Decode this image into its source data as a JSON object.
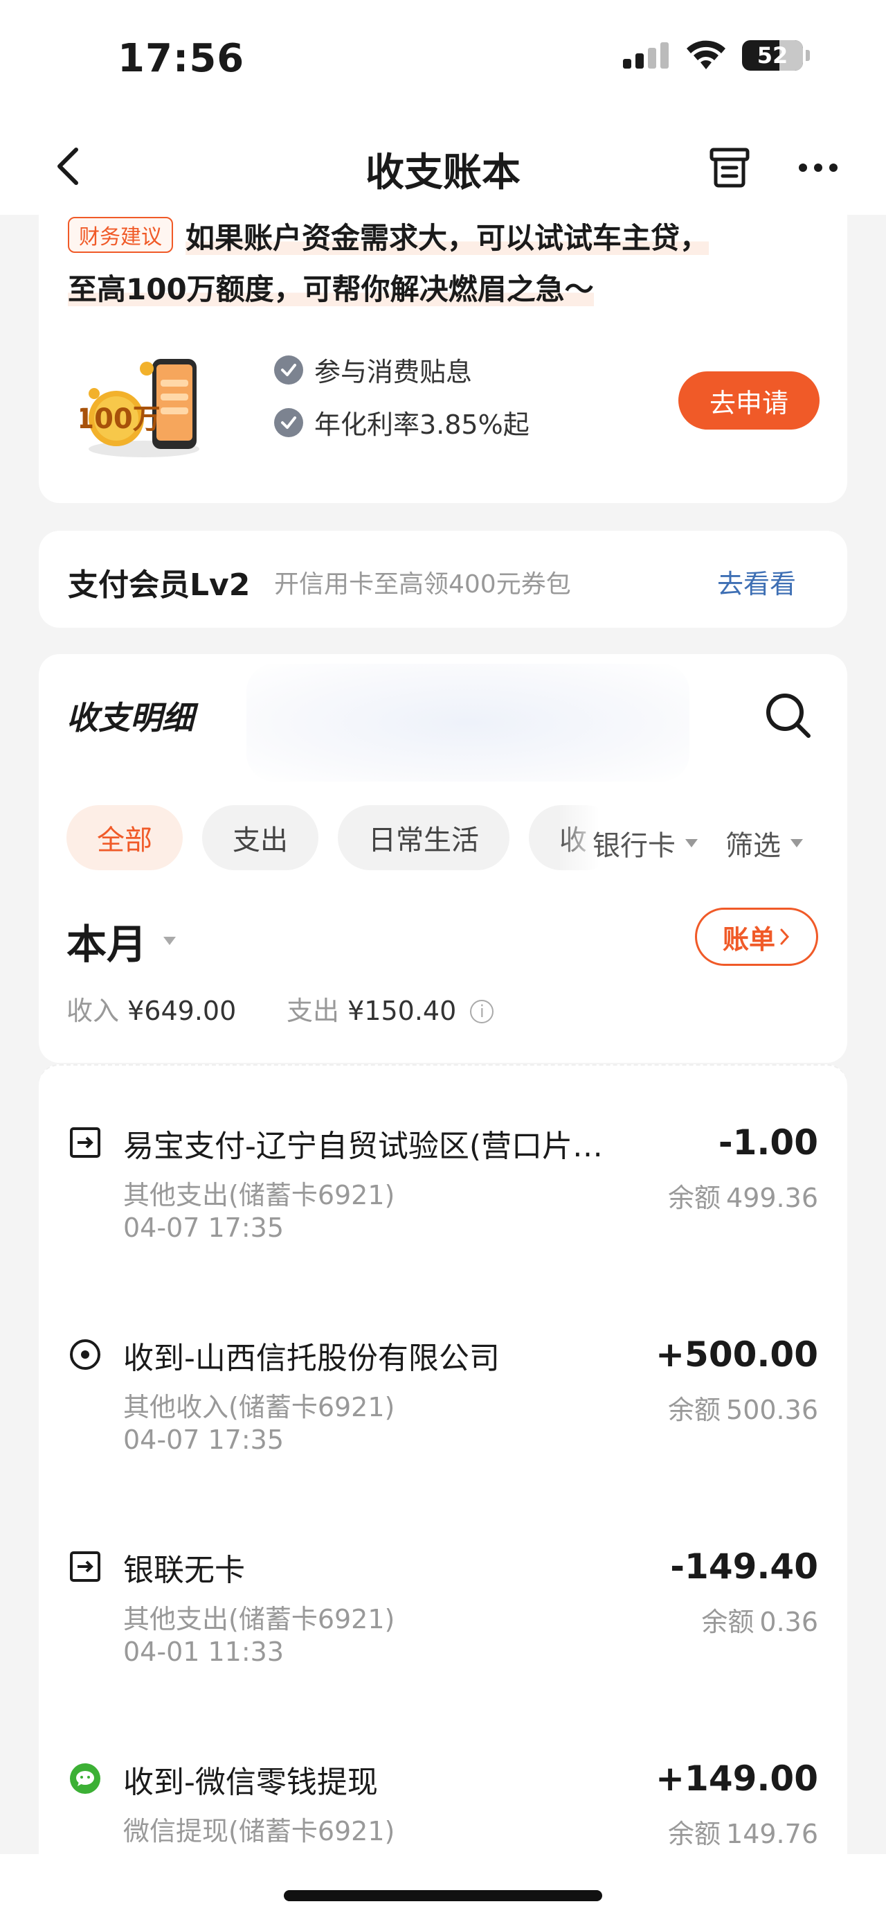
{
  "status_bar": {
    "time": "17:56",
    "battery": "52",
    "icons": [
      "signal-icon",
      "wifi-icon",
      "battery-icon"
    ]
  },
  "nav": {
    "title": "收支账本",
    "back_icon": "chevron-left-icon",
    "archive_icon": "archive-icon",
    "more_icon": "more-icon"
  },
  "loan": {
    "tag": "财务建议",
    "line1": "如果账户资金需求大，可以试试车主贷，",
    "line2": "至高100万额度，可帮你解决燃眉之急～",
    "image_text": "100万",
    "benefits": [
      "参与消费贴息",
      "年化利率3.85%起"
    ],
    "apply_label": "去申请"
  },
  "member": {
    "title": "支付会员Lv2",
    "promo": "开信用卡至高领400元券包",
    "link": "去看看"
  },
  "detail": {
    "title": "收支明细",
    "chips": [
      {
        "label": "全部",
        "active": true
      },
      {
        "label": "支出",
        "active": false
      },
      {
        "label": "日常生活",
        "active": false
      },
      {
        "label": "收",
        "active": false
      }
    ],
    "filters": {
      "bank_card": "银行卡",
      "filter": "筛选"
    },
    "month": "本月",
    "bill_label": "账单",
    "income_label": "收入",
    "income_value": "¥649.00",
    "expense_label": "支出",
    "expense_value": "¥150.40"
  },
  "transactions": [
    {
      "icon": "expense-icon",
      "name": "易宝支付-辽宁自贸试验区(营口片…",
      "category": "其他支出(储蓄卡6921)",
      "time": "04-07 17:35",
      "amount": "-1.00",
      "balance_label": "余额",
      "balance": "499.36"
    },
    {
      "icon": "income-icon",
      "name": "收到-山西信托股份有限公司",
      "category": "其他收入(储蓄卡6921)",
      "time": "04-07 17:35",
      "amount": "+500.00",
      "balance_label": "余额",
      "balance": "500.36"
    },
    {
      "icon": "expense-icon",
      "name": "银联无卡",
      "category": "其他支出(储蓄卡6921)",
      "time": "04-01 11:33",
      "amount": "-149.40",
      "balance_label": "余额",
      "balance": "0.36"
    },
    {
      "icon": "wechat-icon",
      "name": "收到-微信零钱提现",
      "category": "微信提现(储蓄卡6921)",
      "time": "",
      "amount": "+149.00",
      "balance_label": "余额",
      "balance": "149.76"
    }
  ],
  "colors": {
    "accent": "#f05a28",
    "link": "#3e6fb4",
    "wechat": "#3cb035"
  }
}
